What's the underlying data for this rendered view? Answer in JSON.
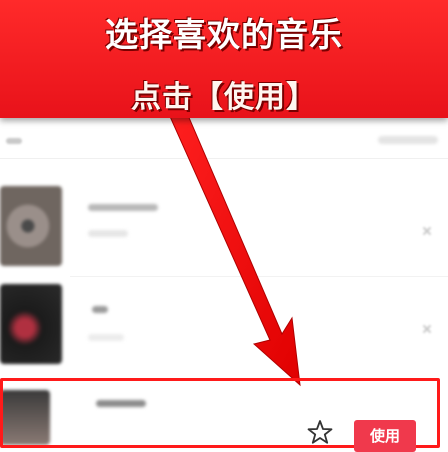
{
  "banner": {
    "title": "选择喜欢的音乐",
    "subtitle": "点击【使用】"
  },
  "selected_row": {
    "use_button_label": "使用",
    "favorite_icon": "star-outline-icon"
  },
  "colors": {
    "banner_red": "#e8121a",
    "highlight_red": "#ff1a1a",
    "button_red": "#f0394c"
  }
}
